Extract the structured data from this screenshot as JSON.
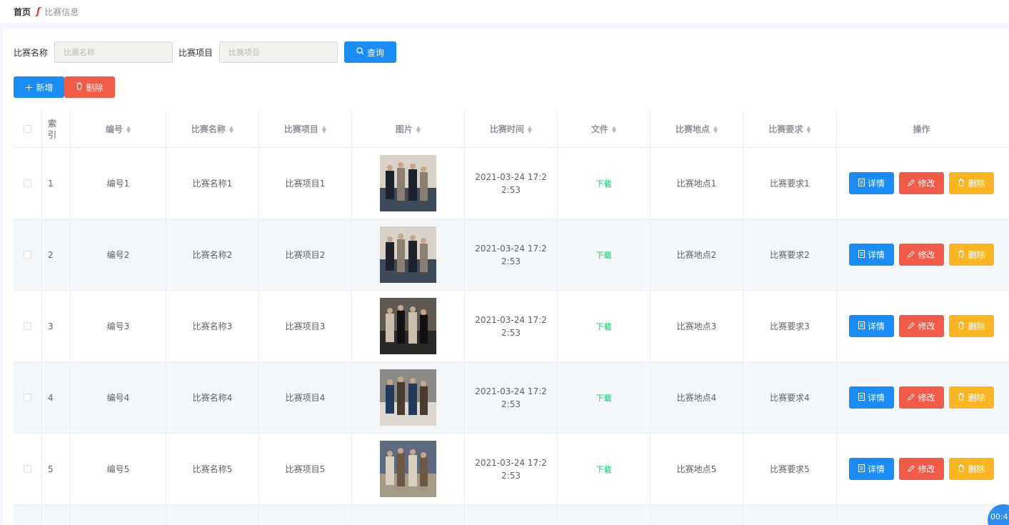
{
  "breadcrumb": {
    "home": "首页",
    "separator": "ʃ",
    "current": "比赛信息"
  },
  "search": {
    "name_label": "比赛名称",
    "name_placeholder": "比赛名称",
    "project_label": "比赛项目",
    "project_placeholder": "比赛项目",
    "query_button": "查询",
    "query_icon": "search-icon"
  },
  "actions": {
    "add_button": "新增",
    "add_icon": "plus-icon",
    "delete_button": "删除",
    "delete_icon": "trash-icon"
  },
  "table": {
    "columns": [
      "索引",
      "编号",
      "比赛名称",
      "比赛项目",
      "图片",
      "比赛时间",
      "文件",
      "比赛地点",
      "比赛要求",
      "操作"
    ],
    "rows": [
      {
        "index": "1",
        "code": "编号1",
        "name": "比赛名称1",
        "project": "比赛项目1",
        "time": "2021-03-24 17:22:53",
        "file": "下载",
        "place": "比赛地点1",
        "requirement": "比赛要求1"
      },
      {
        "index": "2",
        "code": "编号2",
        "name": "比赛名称2",
        "project": "比赛项目2",
        "time": "2021-03-24 17:22:53",
        "file": "下载",
        "place": "比赛地点2",
        "requirement": "比赛要求2"
      },
      {
        "index": "3",
        "code": "编号3",
        "name": "比赛名称3",
        "project": "比赛项目3",
        "time": "2021-03-24 17:22:53",
        "file": "下载",
        "place": "比赛地点3",
        "requirement": "比赛要求3"
      },
      {
        "index": "4",
        "code": "编号4",
        "name": "比赛名称4",
        "project": "比赛项目4",
        "time": "2021-03-24 17:22:53",
        "file": "下载",
        "place": "比赛地点4",
        "requirement": "比赛要求4"
      },
      {
        "index": "5",
        "code": "编号5",
        "name": "比赛名称5",
        "project": "比赛项目5",
        "time": "2021-03-24 17:22:53",
        "file": "下载",
        "place": "比赛地点5",
        "requirement": "比赛要求5"
      }
    ],
    "row_buttons": {
      "detail": "详情",
      "edit": "修改",
      "delete": "删除"
    }
  },
  "timer": "00:4",
  "colors": {
    "primary": "#1a8cf5",
    "danger": "#f25b47",
    "warning": "#fbb520",
    "success": "#13ce66"
  }
}
